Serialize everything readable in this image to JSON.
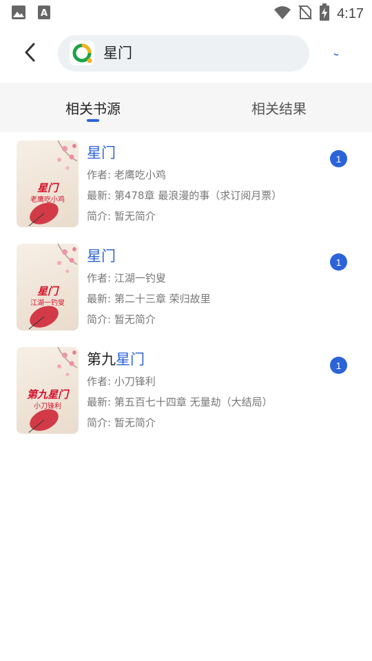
{
  "status_bar": {
    "time": "4:17",
    "left_icons": [
      "image-icon",
      "font-a-icon"
    ],
    "right_icons": [
      "wifi-icon",
      "no-sim-icon",
      "battery-charging-icon"
    ]
  },
  "header": {
    "search_value": "星门",
    "back_icon": "chevron-left-icon",
    "logo_icon": "app-logo-icon"
  },
  "tabs": [
    {
      "label": "相关书源",
      "active": true
    },
    {
      "label": "相关结果",
      "active": false
    }
  ],
  "colors": {
    "accent": "#2b63d9",
    "cover_text": "#d4112a"
  },
  "results": [
    {
      "title_prefix": "",
      "title_highlight": "星门",
      "author": "作者: 老鹰吃小鸡",
      "latest": "最新: 第478章 最浪漫的事（求订阅月票）",
      "intro": "简介: 暂无简介",
      "badge": "1",
      "cover_title": "星门",
      "cover_author": "老鹰吃小鸡"
    },
    {
      "title_prefix": "",
      "title_highlight": "星门",
      "author": "作者: 江湖一钓叟",
      "latest": "最新: 第二十三章 荣归故里",
      "intro": "简介: 暂无简介",
      "badge": "1",
      "cover_title": "星门",
      "cover_author": "江湖一钓叟"
    },
    {
      "title_prefix": "第九",
      "title_highlight": "星门",
      "author": "作者: 小刀锋利",
      "latest": "最新: 第五百七十四章 无量劫（大结局）",
      "intro": "简介: 暂无简介",
      "badge": "1",
      "cover_title": "第九星门",
      "cover_author": "小刀锋利"
    }
  ]
}
